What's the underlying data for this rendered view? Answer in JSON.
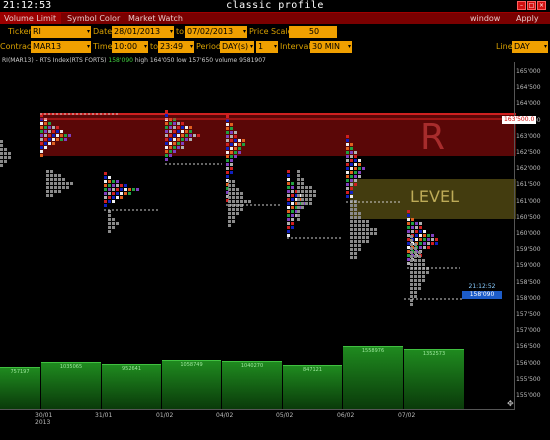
{
  "titlebar": {
    "clock": "21:12:53",
    "title": "classic profile",
    "min": "–",
    "max": "□",
    "close": "×"
  },
  "menu": {
    "items": [
      "Volume Limit",
      "Symbol Color",
      "Market Watch"
    ],
    "window": "window",
    "apply": "Apply"
  },
  "toolbar": {
    "ticker_label": "Ticker",
    "ticker": "RI",
    "date_label": "Date",
    "date_from": "28/01/2013",
    "to_label": "to",
    "date_to": "07/02/2013",
    "price_scale_label": "Price Scale",
    "price_scale": "50",
    "contract_label": "Contract",
    "contract": "MAR13",
    "time_label": "Time",
    "time_from": "10:00",
    "time_to": "23:49",
    "period_label": "Period",
    "period": "DAY(s)",
    "period_count": "1",
    "interval_label": "Interval",
    "interval": "30 MIN",
    "line_label": "Line",
    "line": "DAY"
  },
  "info": {
    "symbol": "RI(MAR13) - RTS Index(RTS FORTS)",
    "last": "158'090",
    "high": "high 164'050",
    "low": "low 157'650",
    "volume": "volume 9581907"
  },
  "y_ticks": [
    "165'000",
    "164'500",
    "164'000",
    "163'500",
    "163'000",
    "162'500",
    "162'000",
    "161'500",
    "161'000",
    "160'500",
    "160'000",
    "159'500",
    "159'000",
    "158'500",
    "158'000",
    "157'500",
    "157'000",
    "156'500",
    "156'000",
    "155'500",
    "155'000"
  ],
  "x_ticks": [
    "30/01",
    "31/01",
    "01/02",
    "04/02",
    "05/02",
    "06/02",
    "07/02"
  ],
  "x_year": "2013",
  "zones": {
    "r_label": "R",
    "level_label": "LEVEL"
  },
  "price_tag": "163'500.0",
  "current_time": "21:12:52",
  "current_price": "158'090",
  "volumes": [
    "757197",
    "1035065",
    "952641",
    "1058749",
    "1040270",
    "847121",
    "1558976",
    "1352573"
  ],
  "colors": {
    "menu_bg": "#7a0000",
    "field": "#f0a000",
    "zone_r": "#780a0a",
    "zone_level": "#5a5014",
    "volume": "#1f8a1f",
    "price_tag_text": "#cc0000"
  }
}
